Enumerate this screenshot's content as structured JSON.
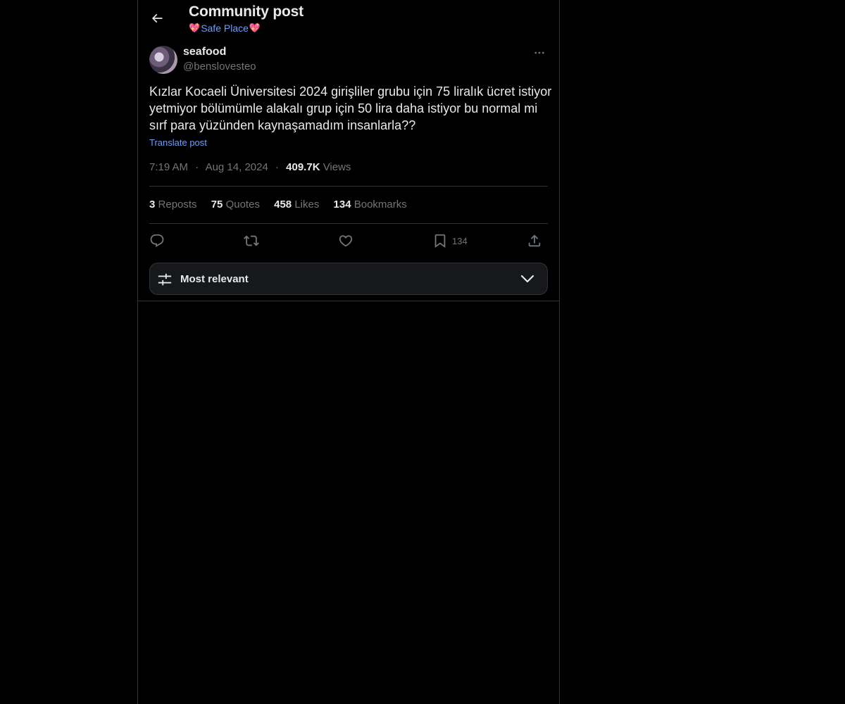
{
  "header": {
    "title": "Community post",
    "community_name": "Safe Place",
    "heart_glyph": "💖"
  },
  "author": {
    "name": "seafood",
    "handle": "@benslovesteo"
  },
  "post": {
    "text": "Kızlar Kocaeli Üniversitesi 2024 girişliler grubu için 75 liralık ücret istiyor yetmiyor bölümümle alakalı grup için 50 lira daha istiyor bu normal mi sırf para yüzünden kaynaşamadım insanlarla??",
    "translate_label": "Translate post",
    "time": "7:19 AM",
    "date": "Aug 14, 2024",
    "separator": "·",
    "views_count": "409.7K",
    "views_label": "Views"
  },
  "stats": [
    {
      "count": "3",
      "label": "Reposts"
    },
    {
      "count": "75",
      "label": "Quotes"
    },
    {
      "count": "458",
      "label": "Likes"
    },
    {
      "count": "134",
      "label": "Bookmarks"
    }
  ],
  "actions": {
    "reply_icon": "reply-icon",
    "repost_icon": "repost-icon",
    "like_icon": "heart-icon",
    "bookmark_icon": "bookmark-icon",
    "bookmark_count": "134",
    "share_icon": "share-icon"
  },
  "sort": {
    "label": "Most relevant"
  },
  "colors": {
    "background": "#000000",
    "text": "#e7e9ea",
    "muted": "#71767b",
    "link": "#6f9ef5",
    "border": "#2f3336"
  }
}
